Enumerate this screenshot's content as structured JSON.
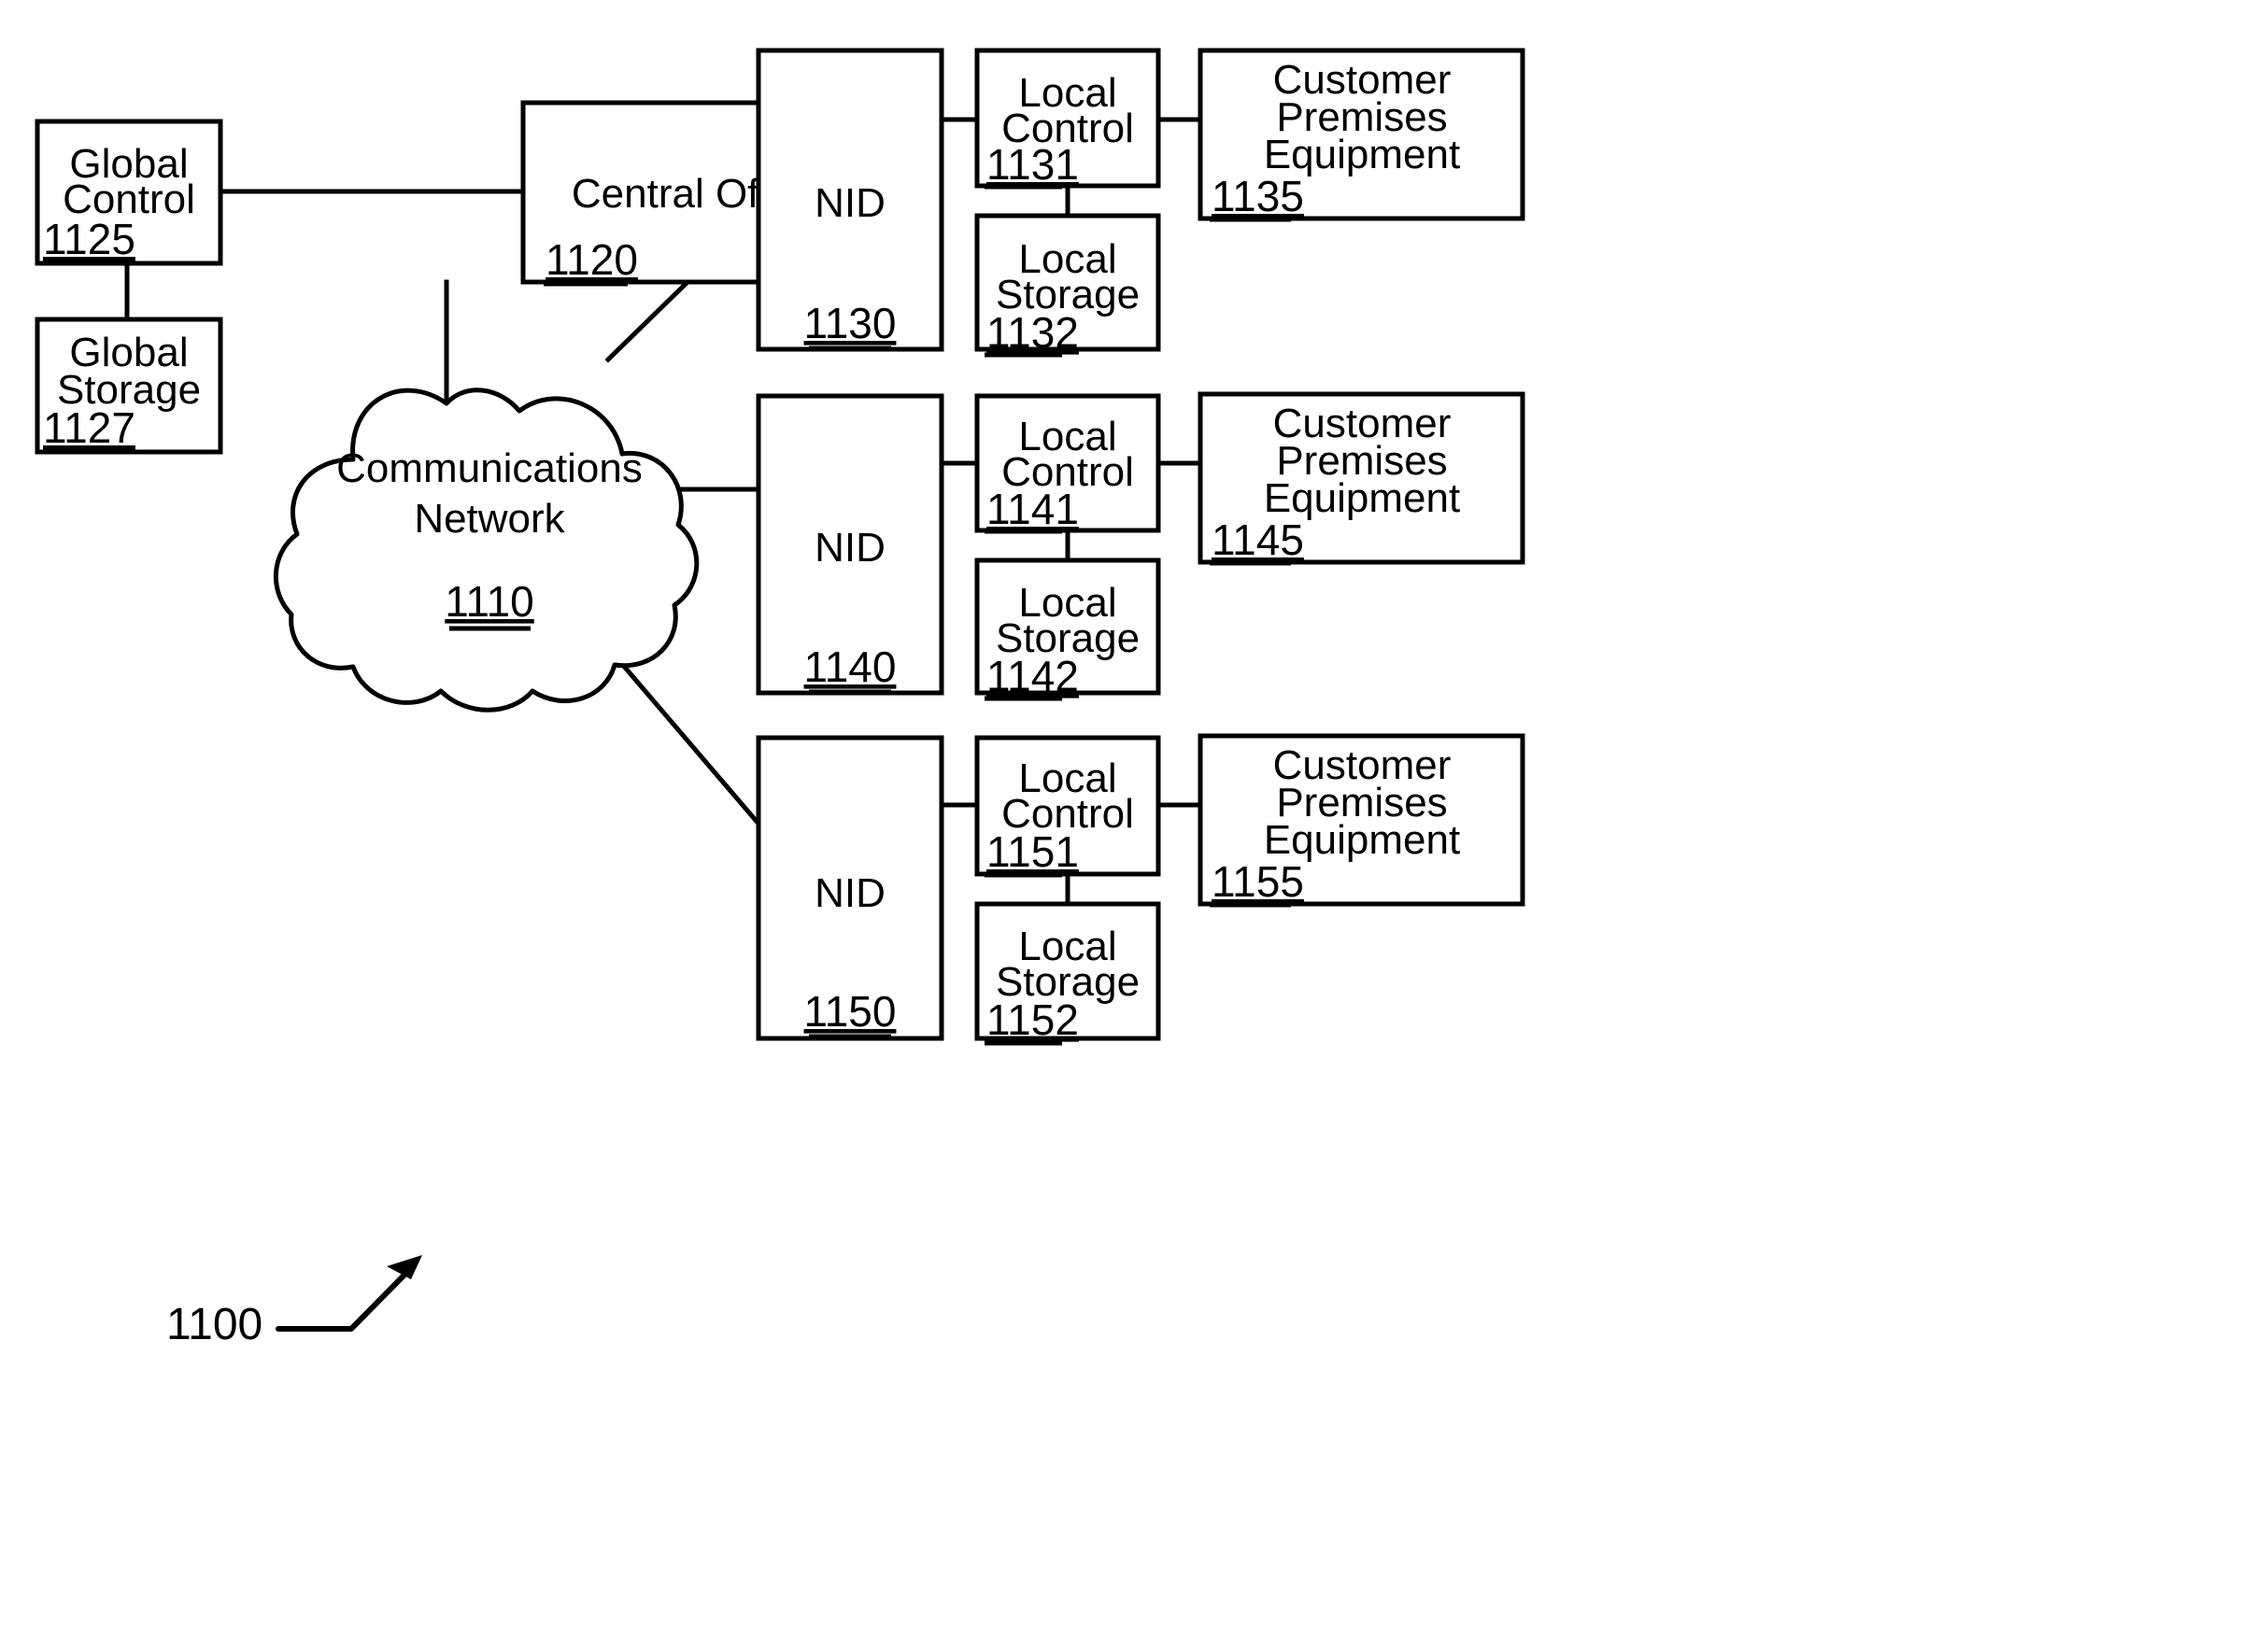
{
  "figure": {
    "figure_number": "1100",
    "nodes": {
      "global_control": {
        "title_line1": "Global",
        "title_line2": "Control",
        "ref": "1125"
      },
      "global_storage": {
        "title_line1": "Global",
        "title_line2": "Storage",
        "ref": "1127"
      },
      "central_office": {
        "title_line1": "Central Office",
        "ref": "1120"
      },
      "communications_network": {
        "title_line1": "Communications",
        "title_line2": "Network",
        "ref": "1110"
      },
      "nid_1": {
        "title_line1": "NID",
        "ref": "1130"
      },
      "local_control_1": {
        "title_line1": "Local",
        "title_line2": "Control",
        "ref": "1131"
      },
      "local_storage_1": {
        "title_line1": "Local",
        "title_line2": "Storage",
        "ref": "1132"
      },
      "cpe_1": {
        "title_line1": "Customer",
        "title_line2": "Premises",
        "title_line3": "Equipment",
        "ref": "1135"
      },
      "nid_2": {
        "title_line1": "NID",
        "ref": "1140"
      },
      "local_control_2": {
        "title_line1": "Local",
        "title_line2": "Control",
        "ref": "1141"
      },
      "local_storage_2": {
        "title_line1": "Local",
        "title_line2": "Storage",
        "ref": "1142"
      },
      "cpe_2": {
        "title_line1": "Customer",
        "title_line2": "Premises",
        "title_line3": "Equipment",
        "ref": "1145"
      },
      "nid_3": {
        "title_line1": "NID",
        "ref": "1150"
      },
      "local_control_3": {
        "title_line1": "Local",
        "title_line2": "Control",
        "ref": "1151"
      },
      "local_storage_3": {
        "title_line1": "Local",
        "title_line2": "Storage",
        "ref": "1152"
      },
      "cpe_3": {
        "title_line1": "Customer",
        "title_line2": "Premises",
        "title_line3": "Equipment",
        "ref": "1155"
      }
    },
    "colors": {
      "stroke": "#000000",
      "fill": "#ffffff",
      "background": "#ffffff"
    }
  }
}
